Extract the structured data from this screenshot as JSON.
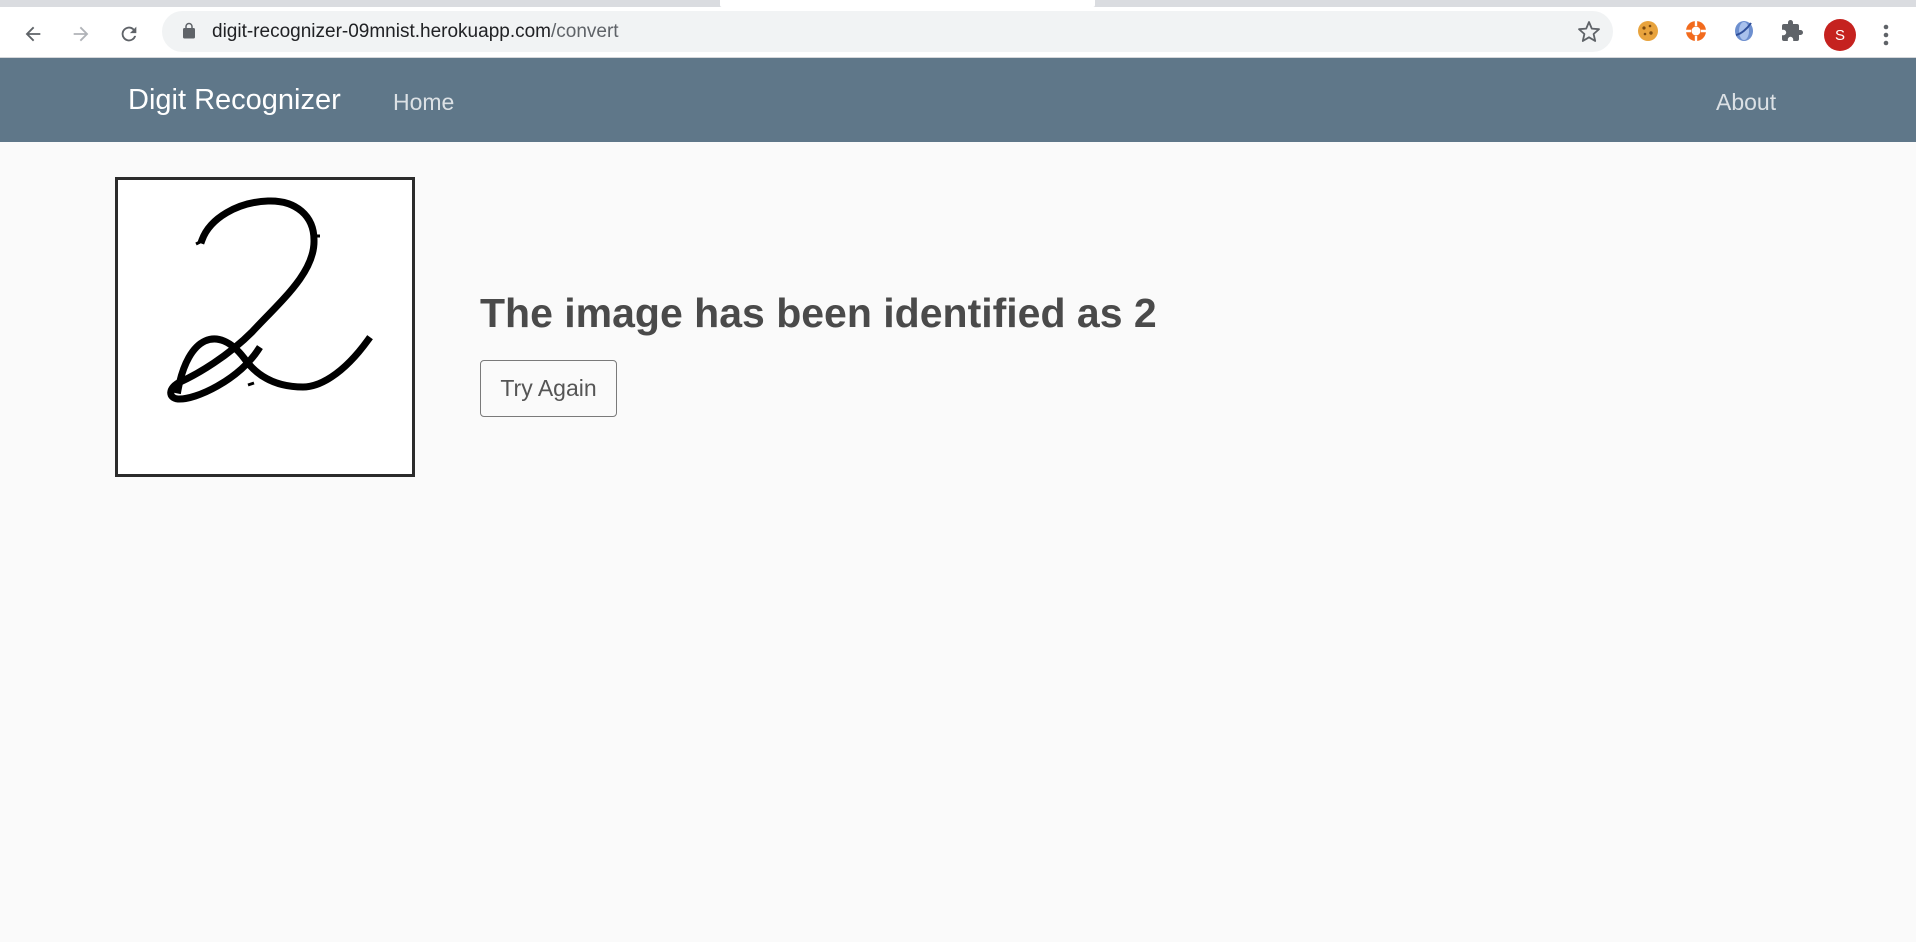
{
  "browser": {
    "url_host": "digit-recognizer-09mnist.herokuapp.com",
    "url_path": "/convert",
    "profile_initial": "S",
    "icons": [
      "back-icon",
      "forward-icon",
      "reload-icon",
      "lock-icon",
      "bookmark-star-icon",
      "cookie-extension-icon",
      "lifebuoy-extension-icon",
      "globe-extension-icon",
      "puzzle-extensions-icon",
      "more-menu-icon"
    ]
  },
  "navbar": {
    "brand": "Digit Recognizer",
    "home": "Home",
    "about": "About",
    "color": "#5f7789"
  },
  "main": {
    "result_text": "The image has been identified as 2",
    "try_again_label": "Try Again"
  }
}
